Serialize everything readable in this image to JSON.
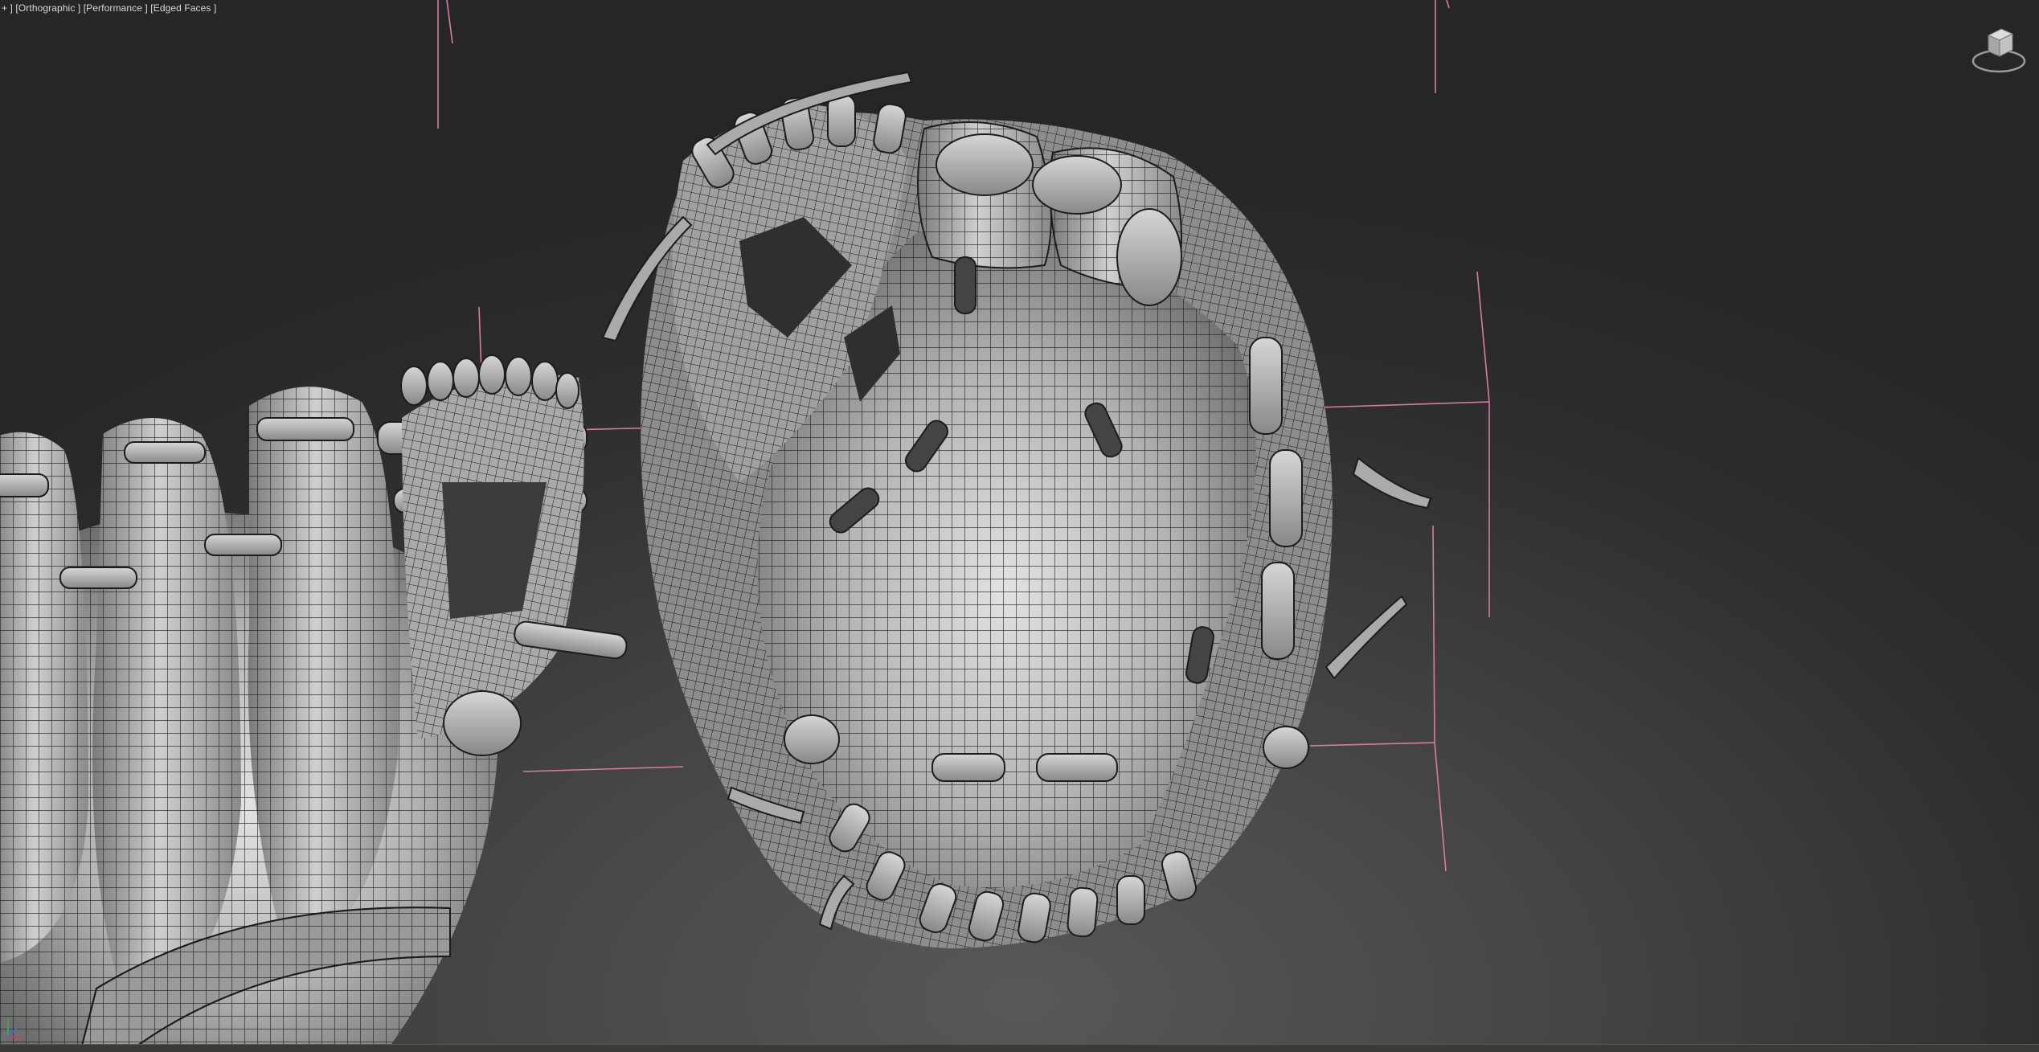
{
  "viewport": {
    "label_prefix": "+ ]",
    "view_mode": "[Orthographic ]",
    "performance_mode": "[Performance ]",
    "shading_mode": "[Edged Faces ]"
  },
  "icons": {
    "viewcube": "viewcube-icon",
    "axis_tripod": "axis-tripod-icon"
  },
  "colors": {
    "viewport_bg": "#3a3a3a",
    "mesh_fill": "#b9b9b9",
    "mesh_wire": "#1c1c1c",
    "gizmo_line": "#d77ba6",
    "label_text": "#d8d8d8"
  }
}
